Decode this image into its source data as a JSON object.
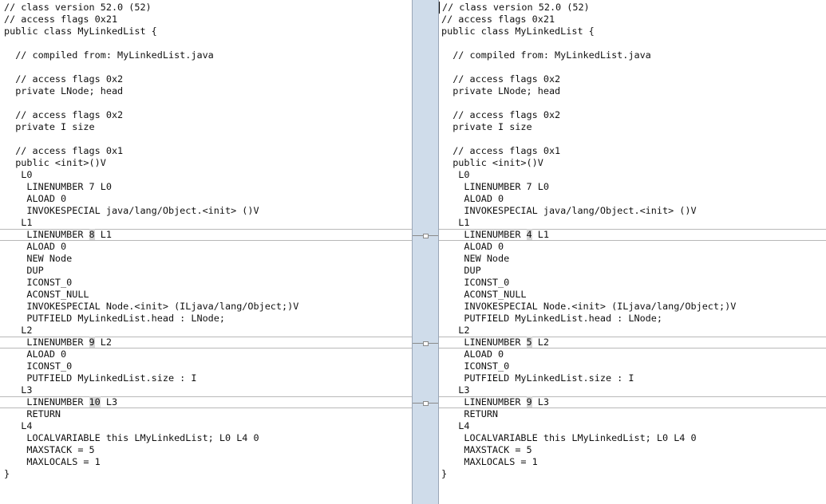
{
  "left_pane": {
    "lines": [
      "// class version 52.0 (52)",
      "// access flags 0x21",
      "public class MyLinkedList {",
      "",
      "  // compiled from: MyLinkedList.java",
      "",
      "  // access flags 0x2",
      "  private LNode; head",
      "",
      "  // access flags 0x2",
      "  private I size",
      "",
      "  // access flags 0x1",
      "  public <init>()V",
      "   L0",
      "    LINENUMBER 7 L0",
      "    ALOAD 0",
      "    INVOKESPECIAL java/lang/Object.<init> ()V",
      "   L1",
      "    LINENUMBER 8 L1",
      "    ALOAD 0",
      "    NEW Node",
      "    DUP",
      "    ICONST_0",
      "    ACONST_NULL",
      "    INVOKESPECIAL Node.<init> (ILjava/lang/Object;)V",
      "    PUTFIELD MyLinkedList.head : LNode;",
      "   L2",
      "    LINENUMBER 9 L2",
      "    ALOAD 0",
      "    ICONST_0",
      "    PUTFIELD MyLinkedList.size : I",
      "   L3",
      "    LINENUMBER 10 L3",
      "    RETURN",
      "   L4",
      "    LOCALVARIABLE this LMyLinkedList; L0 L4 0",
      "    MAXSTACK = 5",
      "    MAXLOCALS = 1",
      "}"
    ]
  },
  "right_pane": {
    "lines": [
      "// class version 52.0 (52)",
      "// access flags 0x21",
      "public class MyLinkedList {",
      "",
      "  // compiled from: MyLinkedList.java",
      "",
      "  // access flags 0x2",
      "  private LNode; head",
      "",
      "  // access flags 0x2",
      "  private I size",
      "",
      "  // access flags 0x1",
      "  public <init>()V",
      "   L0",
      "    LINENUMBER 7 L0",
      "    ALOAD 0",
      "    INVOKESPECIAL java/lang/Object.<init> ()V",
      "   L1",
      "    LINENUMBER 4 L1",
      "    ALOAD 0",
      "    NEW Node",
      "    DUP",
      "    ICONST_0",
      "    ACONST_NULL",
      "    INVOKESPECIAL Node.<init> (ILjava/lang/Object;)V",
      "    PUTFIELD MyLinkedList.head : LNode;",
      "   L2",
      "    LINENUMBER 5 L2",
      "    ALOAD 0",
      "    ICONST_0",
      "    PUTFIELD MyLinkedList.size : I",
      "   L3",
      "    LINENUMBER 9 L3",
      "    RETURN",
      "   L4",
      "    LOCALVARIABLE this LMyLinkedList; L0 L4 0",
      "    MAXSTACK = 5",
      "    MAXLOCALS = 1",
      "}"
    ]
  },
  "changes": [
    {
      "line_index": 19,
      "left": {
        "prefix": "    LINENUMBER ",
        "value": "8",
        "suffix": " L1"
      },
      "right": {
        "prefix": "    LINENUMBER ",
        "value": "4",
        "suffix": " L1"
      }
    },
    {
      "line_index": 28,
      "left": {
        "prefix": "    LINENUMBER ",
        "value": "9",
        "suffix": " L2"
      },
      "right": {
        "prefix": "    LINENUMBER ",
        "value": "5",
        "suffix": " L2"
      }
    },
    {
      "line_index": 33,
      "left": {
        "prefix": "    LINENUMBER ",
        "value": "10",
        "suffix": " L3"
      },
      "right": {
        "prefix": "    LINENUMBER ",
        "value": "9",
        "suffix": " L3"
      }
    }
  ],
  "colors": {
    "gutter": "#cfdcea",
    "change_highlight": "#d8d8d8",
    "change_border": "#b8b8b8"
  }
}
